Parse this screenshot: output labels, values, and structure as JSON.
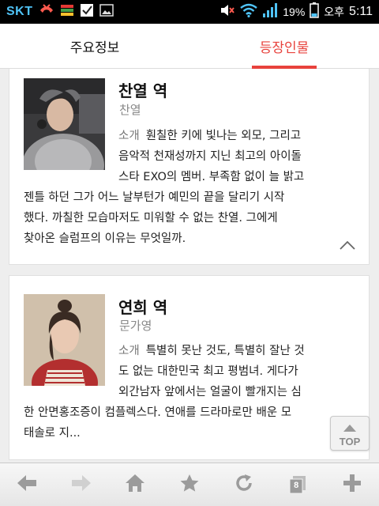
{
  "status_bar": {
    "carrier": "SKT",
    "battery_percent": "19%",
    "ampm": "오후",
    "time": "5:11"
  },
  "tabs": [
    {
      "label": "주요정보",
      "active": false
    },
    {
      "label": "등장인물",
      "active": true
    }
  ],
  "characters": [
    {
      "role": "찬열 역",
      "actor": "찬열",
      "desc_label": "소개",
      "lines": [
        "훤칠한 키에 빛나는 외모, 그리고",
        "음악적 천재성까지 지닌 최고의 아이돌",
        "스타 EXO의 멤버. 부족함 없이 늘 밝고",
        "젠틀 하던 그가 어느 날부턴가 예민의 끝을 달리기 시작",
        "했다. 까칠한 모습마저도 미워할 수 없는 찬열. 그에게",
        "찾아온 슬럼프의 이유는 무엇일까."
      ]
    },
    {
      "role": "연희 역",
      "actor": "문가영",
      "desc_label": "소개",
      "lines": [
        "특별히 못난 것도, 특별히 잘난 것",
        "도 없는 대한민국 최고 평범녀. 게다가",
        "외간남자 앞에서는 얼굴이 빨개지는 심",
        "한 안면홍조증이 컴플렉스다. 연애를 드라마로만 배운 모",
        "태솔로 지..."
      ]
    }
  ],
  "top_button": {
    "label": "TOP"
  },
  "toolbar": {
    "tab_count": "8"
  },
  "colors": {
    "accent": "#e8423c",
    "statusbar": "#000000",
    "carrier": "#4fc3f7"
  }
}
